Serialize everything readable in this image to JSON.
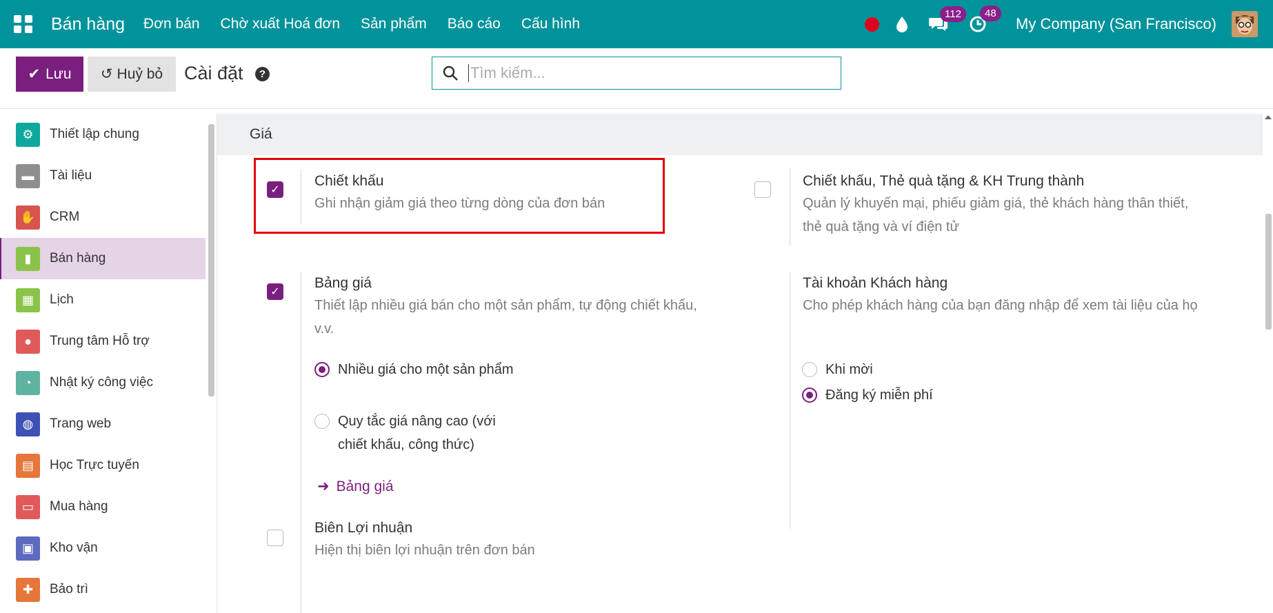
{
  "navbar": {
    "app_name": "Bán hàng",
    "menu": [
      "Đơn bán",
      "Chờ xuất Hoá đơn",
      "Sản phẩm",
      "Báo cáo",
      "Cấu hình"
    ],
    "messages_count": "112",
    "activities_count": "48",
    "company": "My Company (San Francisco)",
    "bg_color": "#00939b"
  },
  "control": {
    "save_label": "Lưu",
    "cancel_label": "Huỷ bỏ",
    "title": "Cài đặt",
    "search_placeholder": "Tìm kiếm...",
    "primary_color": "#7a1f7f"
  },
  "sidebar": {
    "items": [
      {
        "label": "Thiết lập chung",
        "icon": "gear-icon",
        "color": "#0fa89e"
      },
      {
        "label": "Tài liệu",
        "icon": "folder-icon",
        "color": "#8f8f8f"
      },
      {
        "label": "CRM",
        "icon": "handshake-icon",
        "color": "#d9534f"
      },
      {
        "label": "Bán hàng",
        "icon": "sales-chart-icon",
        "color": "#8bc34a"
      },
      {
        "label": "Lịch",
        "icon": "calendar-icon",
        "color": "#8bc34a"
      },
      {
        "label": "Trung tâm Hỗ trợ",
        "icon": "helpdesk-icon",
        "color": "#e05a5a"
      },
      {
        "label": "Nhật ký công việc",
        "icon": "timesheet-icon",
        "color": "#5fb3a1"
      },
      {
        "label": "Trang web",
        "icon": "globe-icon",
        "color": "#3f51b5"
      },
      {
        "label": "Học Trực tuyến",
        "icon": "elearning-icon",
        "color": "#e6763a"
      },
      {
        "label": "Mua hàng",
        "icon": "purchase-icon",
        "color": "#e05a5a"
      },
      {
        "label": "Kho vận",
        "icon": "inventory-icon",
        "color": "#5c6bc0"
      },
      {
        "label": "Bảo trì",
        "icon": "maintenance-icon",
        "color": "#e6763a"
      }
    ],
    "active_index": 3
  },
  "section": {
    "title": "Giá",
    "settings": {
      "discount": {
        "title": "Chiết khấu",
        "desc": "Ghi nhận giảm giá theo từng dòng của đơn bán",
        "checked": true
      },
      "loyalty": {
        "title": "Chiết khấu, Thẻ quà tặng & KH Trung thành",
        "desc": "Quản lý khuyến mại, phiếu giảm giá, thẻ khách hàng thân thiết, thẻ quà tặng và ví điện tử",
        "checked": false
      },
      "pricelist": {
        "title": "Bảng giá",
        "desc": "Thiết lập nhiều giá bán cho một sản phẩm, tự động chiết khấu, v.v.",
        "checked": true,
        "options": [
          {
            "label": "Nhiều giá cho một sản phẩm",
            "selected": true
          },
          {
            "label": "Quy tắc giá nâng cao (với chiết khấu, công thức)",
            "selected": false
          }
        ],
        "link": "Bảng giá"
      },
      "customer_account": {
        "title": "Tài khoản Khách hàng",
        "desc": "Cho phép khách hàng của bạn đăng nhập để xem tài liệu của họ",
        "options": [
          {
            "label": "Khi mời",
            "selected": false
          },
          {
            "label": "Đăng ký miễn phí",
            "selected": true
          }
        ]
      },
      "margin": {
        "title": "Biên Lợi nhuận",
        "desc": "Hiện thị biên lợi nhuận trên đơn bán",
        "checked": false
      }
    }
  }
}
